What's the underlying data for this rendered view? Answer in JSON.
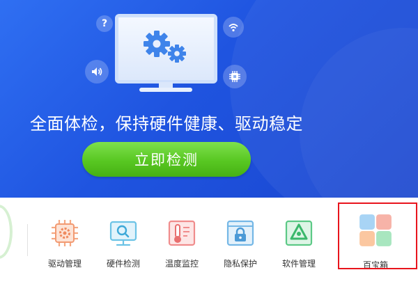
{
  "hero": {
    "headline": "全面体检，保持硬件健康、驱动稳定",
    "cta_label": "立即检测",
    "help_glyph": "?"
  },
  "tools": [
    {
      "label": "驱动管理",
      "icon": "chip-gear-icon"
    },
    {
      "label": "硬件检测",
      "icon": "monitor-search-icon"
    },
    {
      "label": "温度监控",
      "icon": "thermometer-icon"
    },
    {
      "label": "隐私保护",
      "icon": "lock-window-icon"
    },
    {
      "label": "软件管理",
      "icon": "app-store-icon"
    },
    {
      "label": "百宝箱",
      "icon": "tiles-icon"
    }
  ],
  "colors": {
    "hero_bg": "#2057e3",
    "cta_green": "#58c722",
    "highlight_red": "#e8141c"
  }
}
